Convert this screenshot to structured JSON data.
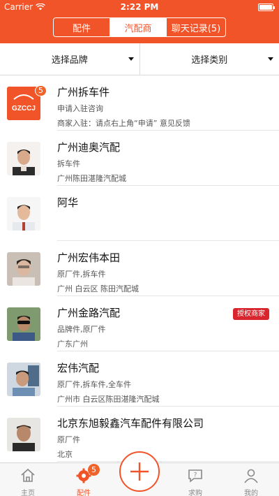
{
  "status_bar": {
    "carrier": "Carrier",
    "time": "2:22 PM"
  },
  "header": {
    "tabs": [
      {
        "label": "配件",
        "active": false
      },
      {
        "label": "汽配商",
        "active": true
      },
      {
        "label": "聊天记录(5)",
        "active": false
      }
    ]
  },
  "filters": {
    "brand": "选择品牌",
    "category": "选择类别"
  },
  "list": [
    {
      "name": "广州拆车件",
      "line1": "申请入驻咨询",
      "line2": "商家入驻：请点右上角“申请”   意见反馈",
      "logo_text": "GZCCJ",
      "count": "5"
    },
    {
      "name": "广州迪奥汽配",
      "line1": "拆车件",
      "line2": "广州陈田湛隆汽配城"
    },
    {
      "name": "阿华",
      "line1": "",
      "line2": ""
    },
    {
      "name": "广州宏伟本田",
      "line1": "原厂件,拆车件",
      "line2": "广州 白云区 陈田汽配城"
    },
    {
      "name": "广州金路汽配",
      "line1": "品牌件,原厂件",
      "line2": "广东广州",
      "badge": "授权商家"
    },
    {
      "name": "宏伟汽配",
      "line1": "原厂件,拆车件,全车件",
      "line2": "广州市 白云区陈田湛隆汽配城"
    },
    {
      "name": "北京东旭毅鑫汽车配件有限公司",
      "line1": "原厂件",
      "line2": "北京"
    }
  ],
  "tabbar": {
    "items": [
      {
        "label": "主页",
        "icon": "home-icon"
      },
      {
        "label": "配件",
        "icon": "gear-icon",
        "badge": "5",
        "active": true
      },
      {
        "label": "求购",
        "icon": "question-chat-icon"
      },
      {
        "label": "我的",
        "icon": "person-icon"
      }
    ],
    "add_icon": "plus-icon"
  },
  "colors": {
    "accent": "#f2542a",
    "badge_red": "#d9252d"
  }
}
